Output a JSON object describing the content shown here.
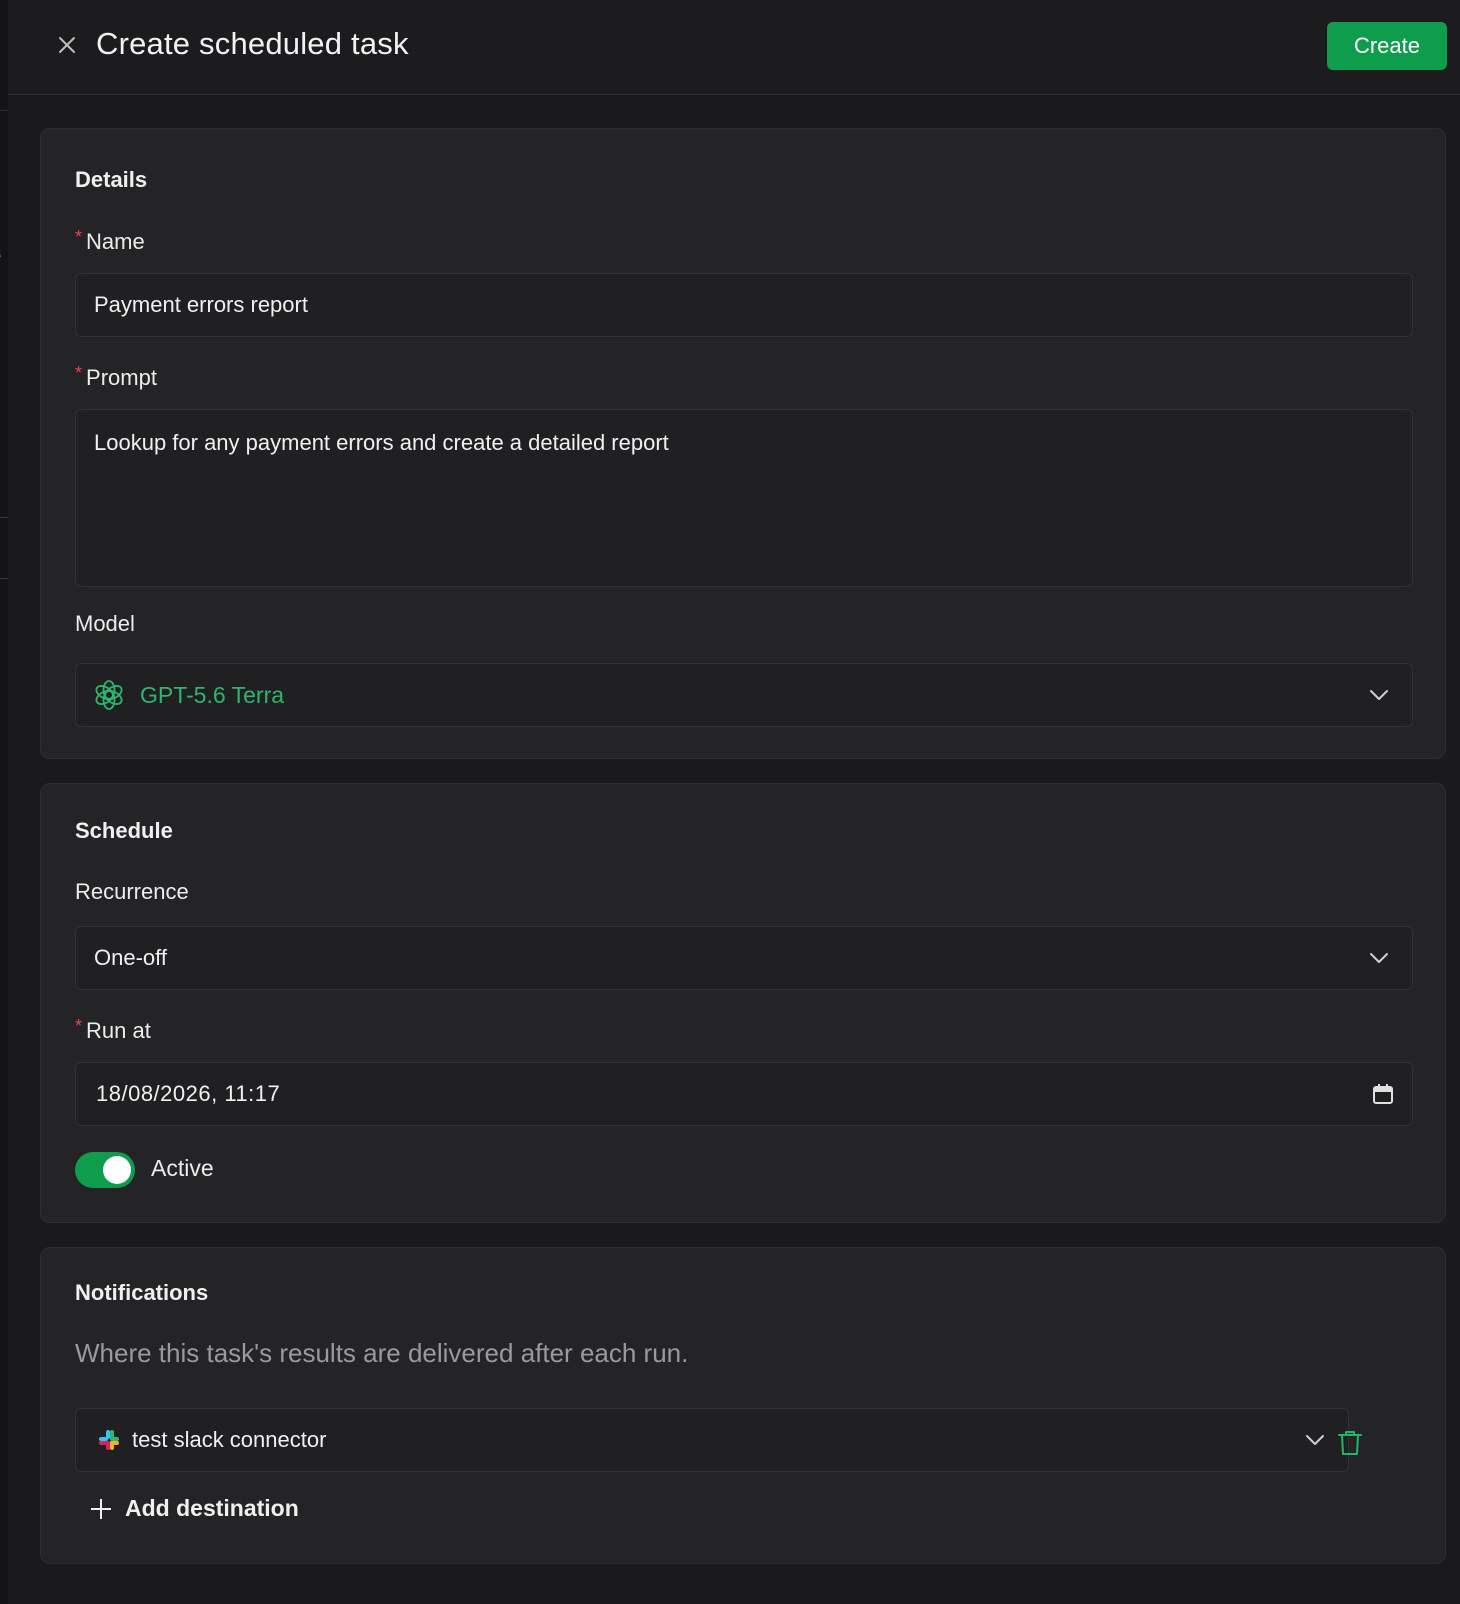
{
  "header": {
    "title": "Create scheduled task",
    "create_label": "Create"
  },
  "details": {
    "section_title": "Details",
    "name": {
      "label": "Name",
      "value": "Payment errors report"
    },
    "prompt": {
      "label": "Prompt",
      "value": "Lookup for any payment errors and create a detailed report"
    },
    "model": {
      "label": "Model",
      "value": "GPT-5.6 Terra",
      "icon": "openai-icon",
      "color": "#2fb56b"
    }
  },
  "schedule": {
    "section_title": "Schedule",
    "recurrence": {
      "label": "Recurrence",
      "value": "One-off"
    },
    "run_at": {
      "label": "Run at",
      "value": "18/08/2026, 11:17",
      "icon": "calendar-icon"
    },
    "active": {
      "label": "Active",
      "on": true,
      "color": "#0e9d4c"
    }
  },
  "notifications": {
    "section_title": "Notifications",
    "help": "Where this task's results are delivered after each run.",
    "destinations": [
      {
        "value": "test slack connector",
        "icon": "slack-icon"
      }
    ],
    "add_label": "Add destination"
  },
  "required_marker": "*",
  "colors": {
    "accent": "#0e9d4c",
    "required": "#e5484d",
    "background": "#1a1a1c",
    "card": "#242426"
  }
}
